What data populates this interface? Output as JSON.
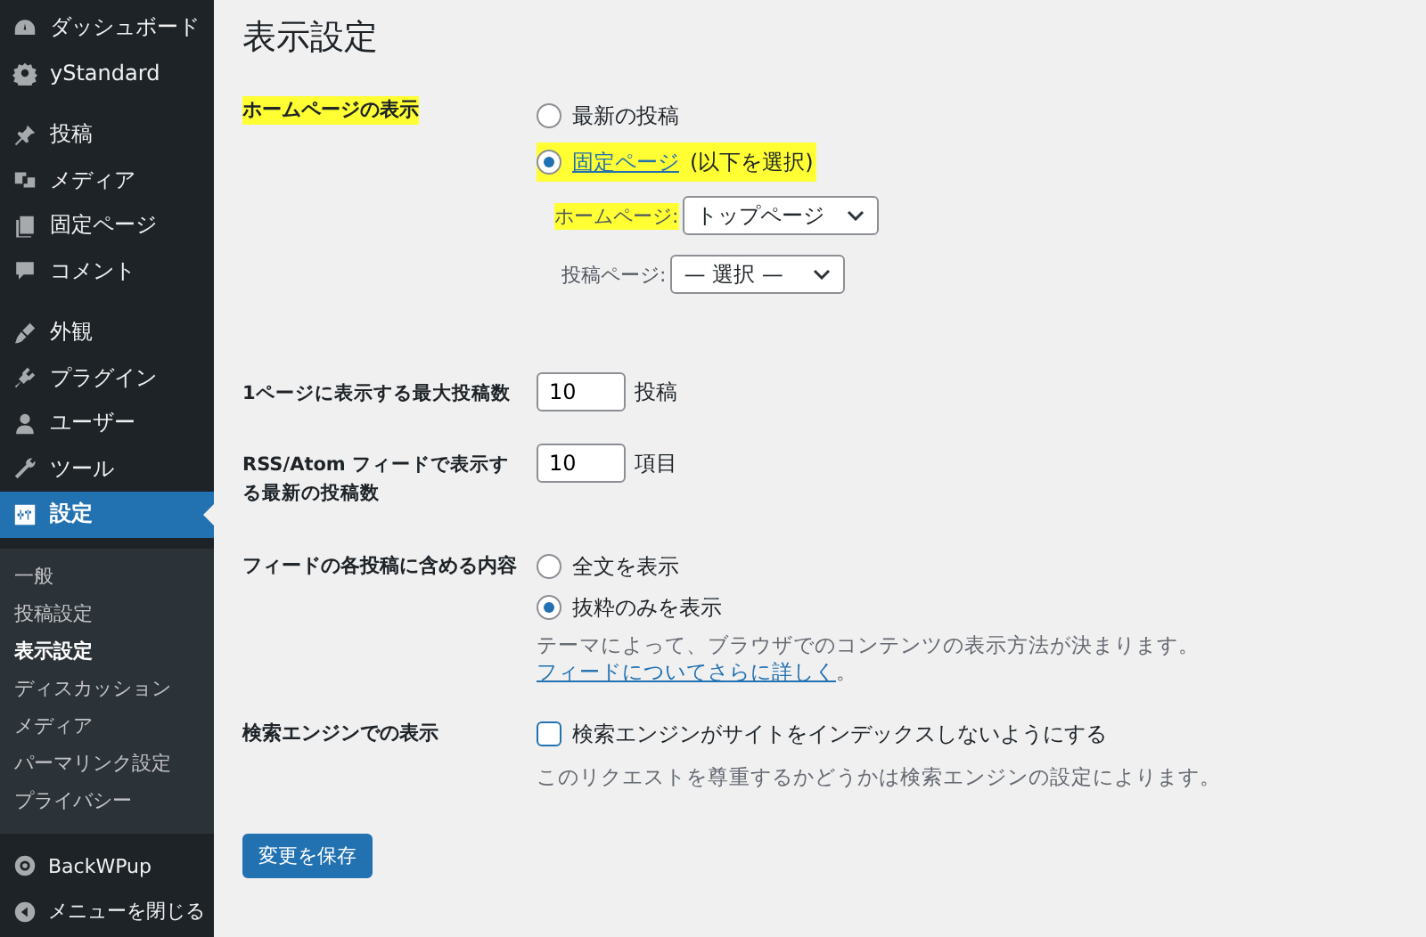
{
  "sidebar": {
    "groups": [
      {
        "items": [
          {
            "label": "ダッシュボード",
            "selected": false
          },
          {
            "label": "yStandard",
            "selected": false
          }
        ]
      },
      {
        "items": [
          {
            "label": "投稿",
            "selected": false
          },
          {
            "label": "メディア",
            "selected": false
          },
          {
            "label": "固定ページ",
            "selected": false
          },
          {
            "label": "コメント",
            "selected": false
          }
        ]
      },
      {
        "items": [
          {
            "label": "外観",
            "selected": false
          },
          {
            "label": "プラグイン",
            "selected": false
          },
          {
            "label": "ユーザー",
            "selected": false
          },
          {
            "label": "ツール",
            "selected": false
          },
          {
            "label": "設定",
            "selected": true
          }
        ]
      }
    ],
    "submenu": [
      {
        "label": "一般",
        "selected": false
      },
      {
        "label": "投稿設定",
        "selected": false
      },
      {
        "label": "表示設定",
        "selected": true
      },
      {
        "label": "ディスカッション",
        "selected": false
      },
      {
        "label": "メディア",
        "selected": false
      },
      {
        "label": "パーマリンク設定",
        "selected": false
      },
      {
        "label": "プライバシー",
        "selected": false
      }
    ],
    "footer": [
      {
        "label": "BackWPup"
      },
      {
        "label": "メニューを閉じる"
      }
    ]
  },
  "page": {
    "title": "表示設定",
    "homepage": {
      "label": "ホームページの表示",
      "highlighted": true,
      "radios": [
        {
          "label": "最新の投稿",
          "selected": false,
          "highlighted": false
        },
        {
          "link": "固定ページ",
          "label": " (以下を選択)",
          "selected": true,
          "highlighted": true
        }
      ],
      "selects": [
        {
          "label": "ホームページ:",
          "value": "トップページ",
          "highlighted": true
        },
        {
          "label": "投稿ページ:",
          "value": "— 選択 —",
          "highlighted": false
        }
      ]
    },
    "number_rows": [
      {
        "label": "1ページに表示する最大投稿数",
        "value": "10",
        "unit": "投稿"
      },
      {
        "label": "RSS/Atom フィードで表示する最新の投稿数",
        "value": "10",
        "unit": "項目"
      }
    ],
    "feed": {
      "label": "フィードの各投稿に含める内容",
      "radios": [
        {
          "label": "全文を表示",
          "selected": false
        },
        {
          "label": "抜粋のみを表示",
          "selected": true
        }
      ],
      "description": "テーマによって、ブラウザでのコンテンツの表示方法が決まります。",
      "link": "フィードについてさらに詳しく",
      "after_link": "。"
    },
    "search": {
      "label": "検索エンジンでの表示",
      "checkbox": "検索エンジンがサイトをインデックスしないようにする",
      "checked": false,
      "description": "このリクエストを尊重するかどうかは検索エンジンの設定によります。"
    },
    "save_button": "変更を保存"
  }
}
